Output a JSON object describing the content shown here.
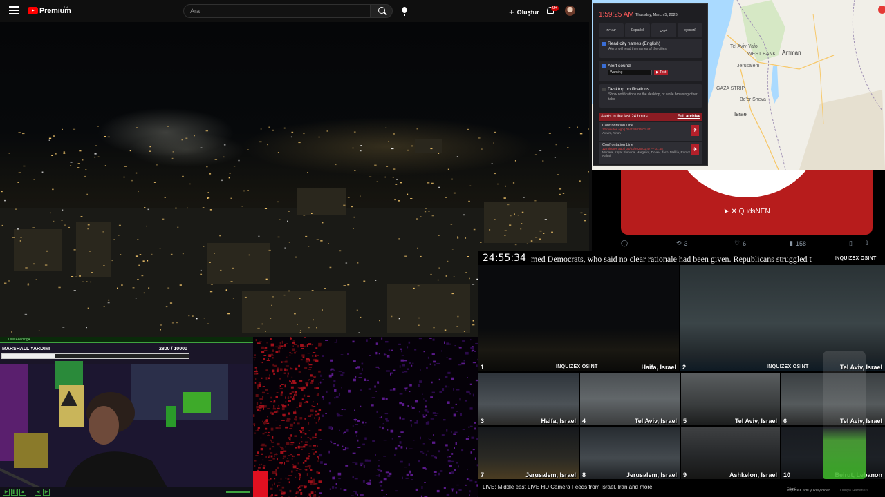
{
  "youtube": {
    "brand": "Premium",
    "country": "TR",
    "search_placeholder": "Ara",
    "create_label": "Oluştur",
    "notification_count": "9+"
  },
  "alert_panel": {
    "time": "1:59:25 AM",
    "date": "Thursday, March 5, 2026",
    "languages": [
      "עברית",
      "Español",
      "عربي",
      "русский"
    ],
    "read_city": {
      "title": "Read city names (English)",
      "sub": "Alerts will read the names of the cities",
      "checked": true
    },
    "alert_sound": {
      "title": "Alert sound",
      "selected": "Warning",
      "test_label": "▶ Test",
      "checked": true
    },
    "desktop": {
      "title": "Desktop notifications",
      "sub": "Show notifications on the desktop, or while browsing other tabs",
      "checked": false
    },
    "alerts_header": "Alerts in the last 24 hours",
    "full_archive": "Full archive",
    "alerts": [
      {
        "title": "Confrontation Line",
        "meta": "12 minutes ago | 05/03/2026 01:47",
        "places": "Avivim, Yir'on"
      },
      {
        "title": "Confrontation Line",
        "meta": "12 minutes ago | 05/03/2026 01:47 — 01:48",
        "places": "Manara, Kiryat Shmona, Margaliot, Dovev, Ifach, Malkia, Ramot Naftali"
      }
    ]
  },
  "map": {
    "labels": [
      "Tel Aviv-Yafo",
      "WEST BANK",
      "Amman",
      "Jerusalem",
      "GAZA STRIP",
      "Be'er Sheva",
      "Israel"
    ]
  },
  "tweet": {
    "handle": "QudsNEN",
    "replies": "",
    "retweets": "3",
    "likes": "6",
    "views": "158"
  },
  "camera_grid": {
    "clock": "24:55:34",
    "ticker": "med Democrats, who said no clear rationale had been given. Republicans struggled t",
    "brand": "INQUIZEX OSINT",
    "cameras": [
      {
        "num": "1",
        "name": "Haifa, Israel"
      },
      {
        "num": "2",
        "name": "Tel Aviv, Israel"
      },
      {
        "num": "3",
        "name": "Haifa, Israel"
      },
      {
        "num": "4",
        "name": "Tel Aviv, Israel"
      },
      {
        "num": "5",
        "name": "Tel Aviv, Israel"
      },
      {
        "num": "6",
        "name": "Tel Aviv, Israel"
      },
      {
        "num": "7",
        "name": "Jerusalem, Israel"
      },
      {
        "num": "8",
        "name": "Jerusalem, Israel"
      },
      {
        "num": "9",
        "name": "Ashkelon, Israel"
      },
      {
        "num": "10",
        "name": "Beirut, Lebanon"
      }
    ],
    "title": "LIVE: Middle east LIVE HD Camera Feeds from Israel, Iran and more",
    "chips": [
      "Tümü",
      "InquizeX adlı yükleyiciden",
      "Dünya Haberleri"
    ]
  },
  "streamer": {
    "bar_label": "Live Feeding4",
    "title": "MARSHALL YARDIMI",
    "score": "2800  /  10000",
    "progress": 0.28
  }
}
